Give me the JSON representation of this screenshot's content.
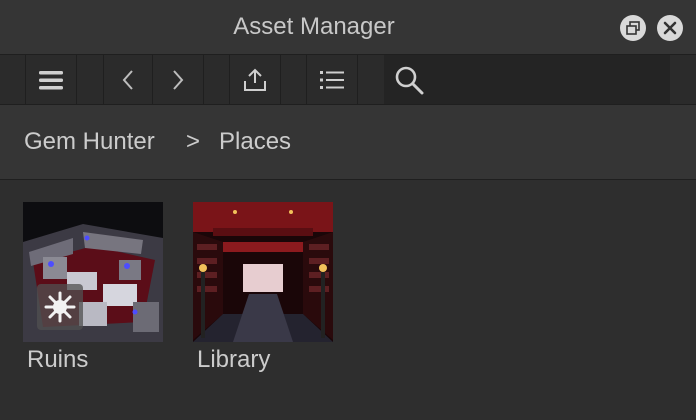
{
  "window": {
    "title": "Asset Manager",
    "restore_icon": "restore-window-icon",
    "close_icon": "close-icon"
  },
  "toolbar": {
    "menu_icon": "hamburger-menu-icon",
    "back_icon": "chevron-left-icon",
    "forward_icon": "chevron-right-icon",
    "import_icon": "upload-icon",
    "list_view_icon": "list-view-icon",
    "search_icon": "search-icon",
    "search_value": ""
  },
  "breadcrumb": {
    "root": "Gem Hunter",
    "separator": ">",
    "current": "Places"
  },
  "assets": [
    {
      "name": "Ruins",
      "start_place_icon": "start-place-icon"
    },
    {
      "name": "Library"
    }
  ],
  "colors": {
    "background": "#2e2e2e",
    "titlebar": "#353535",
    "toolbar": "#2b2b2b",
    "text": "#cccccc"
  }
}
